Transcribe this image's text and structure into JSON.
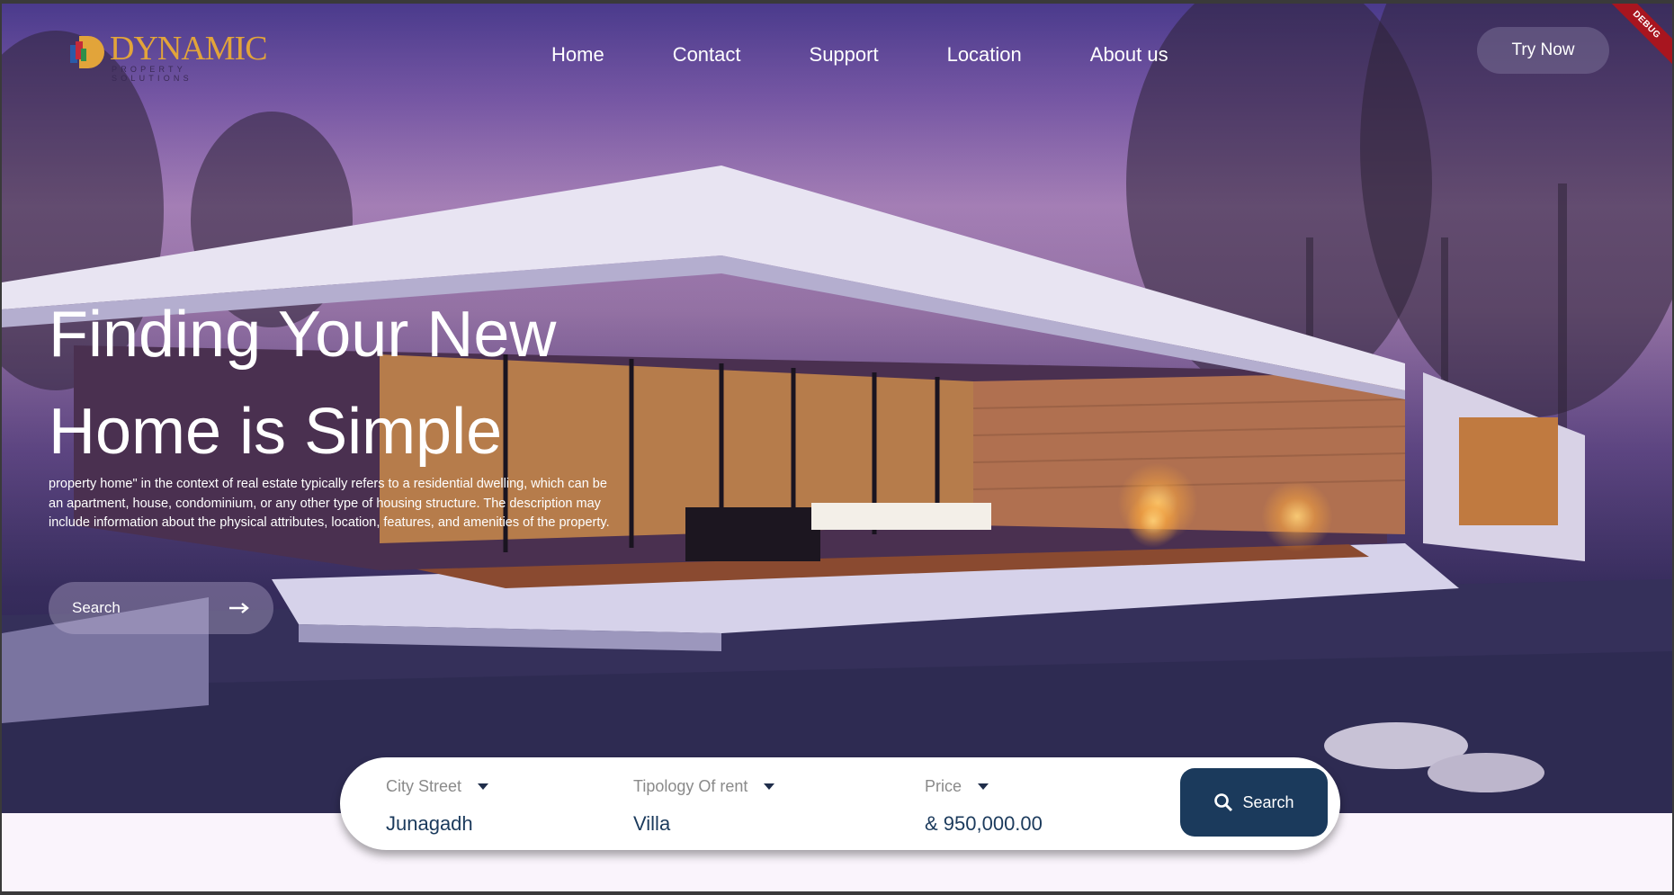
{
  "brand": {
    "name": "DYNAMIC",
    "tagline": "PROPERTY SOLUTIONS"
  },
  "nav": {
    "items": [
      "Home",
      "Contact",
      "Support",
      "Location",
      "About us"
    ]
  },
  "header": {
    "try_now": "Try Now",
    "debug": "DEBUG"
  },
  "hero": {
    "title_line1": "Finding Your New",
    "title_line2": "Home is Simple",
    "description": "property home\" in the context of real estate typically refers to a residential dwelling, which can be an apartment, house, condominium, or any other type of housing structure. The description may include information about the physical attributes, location, features, and amenities of the property.",
    "search_label": "Search"
  },
  "search_panel": {
    "city": {
      "label": "City Street",
      "value": "Junagadh"
    },
    "type": {
      "label": "Tipology Of rent",
      "value": "Villa"
    },
    "price": {
      "label": "Price",
      "value": "& 950,000.00"
    },
    "button": "Search"
  },
  "colors": {
    "accent": "#1b3a5c",
    "logo": "#e2a43a",
    "ribbon": "#a8151f"
  },
  "icons": {
    "hero_search": "arrow-right-icon",
    "panel_search": "search-icon",
    "dropdown": "caret-down-icon"
  }
}
